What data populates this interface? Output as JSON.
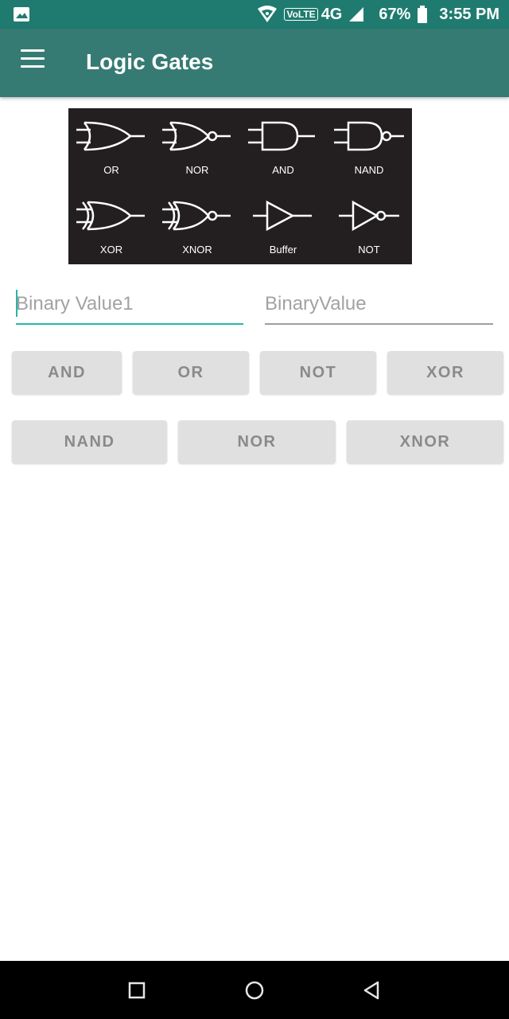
{
  "status_bar": {
    "network": "4G",
    "volte": "VoLTE",
    "battery": "67%",
    "time": "3:55 PM"
  },
  "app_bar": {
    "title": "Logic Gates",
    "menu_icon": "hamburger-menu-icon"
  },
  "gates_image": {
    "labels": [
      "OR",
      "NOR",
      "AND",
      "NAND",
      "XOR",
      "XNOR",
      "Buffer",
      "NOT"
    ]
  },
  "inputs": {
    "first_placeholder": "Binary Value1",
    "second_placeholder": "BinaryValue",
    "first_value": "",
    "second_value": ""
  },
  "buttons": {
    "row1": [
      "AND",
      "OR",
      "NOT",
      "XOR"
    ],
    "row2": [
      "NAND",
      "NOR",
      "XNOR"
    ]
  },
  "nav_bar": {
    "recents_icon": "square-recents-icon",
    "home_icon": "circle-home-icon",
    "back_icon": "triangle-back-icon"
  },
  "colors": {
    "status_bar": "#1f7b6f",
    "app_bar": "#367b73",
    "accent": "#25b6a8",
    "button_bg": "#e0e0e0",
    "button_text": "#8a8a8a"
  }
}
